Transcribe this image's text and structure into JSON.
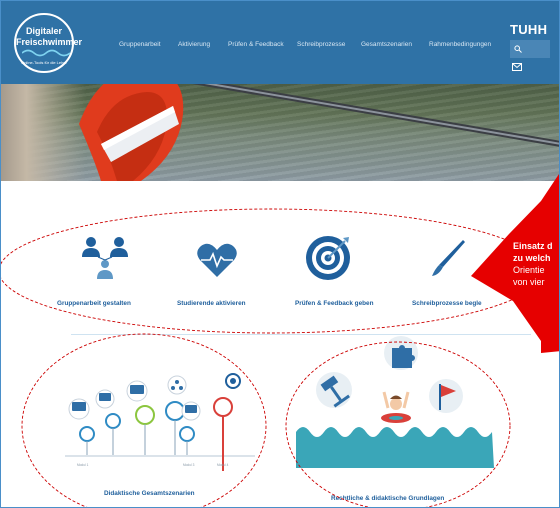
{
  "logo": {
    "line1": "Digitaler",
    "line2": "Freischwimmer",
    "tagline": "Online-Tools für die Lehre"
  },
  "nav": {
    "items": [
      {
        "label": "Gruppenarbeit"
      },
      {
        "label": "Aktivierung"
      },
      {
        "label": "Prüfen & Feedback"
      },
      {
        "label": "Schreibprozesse"
      },
      {
        "label": "Gesamtszenarien"
      },
      {
        "label": "Rahmenbedingungen"
      }
    ]
  },
  "brand": {
    "name": "TUHH"
  },
  "tiles": {
    "group": "Gruppenarbeit gestalten",
    "activate": "Studierende aktivieren",
    "exam": "Prüfen & Feedback geben",
    "writing": "Schreibprozesse begle",
    "scenarios": "Didaktische Gesamtszenarien",
    "legal": "Rechtliche & didaktische Grundlagen"
  },
  "scenario_illustration": {
    "pins": [
      "",
      "",
      "",
      "",
      ""
    ],
    "footer_left": "Modul 1",
    "footer_mid": "Modul 3",
    "footer_right": "Modul 4"
  },
  "callout": {
    "line1": "Einsatz d",
    "line2": "zu welch",
    "line3": "Orientie",
    "line4": "von vier"
  },
  "colors": {
    "header_bg": "#2f72a6",
    "tile_blue": "#1f5f9c",
    "callout_red": "#e60000",
    "ellipse_red": "#cc0000"
  }
}
